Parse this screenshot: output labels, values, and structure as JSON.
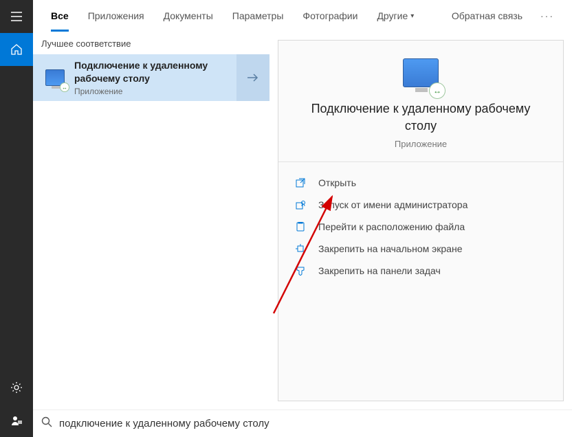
{
  "tabs": {
    "items": [
      {
        "label": "Все",
        "active": true
      },
      {
        "label": "Приложения",
        "active": false
      },
      {
        "label": "Документы",
        "active": false
      },
      {
        "label": "Параметры",
        "active": false
      },
      {
        "label": "Фотографии",
        "active": false
      },
      {
        "label": "Другие",
        "active": false,
        "has_dropdown": true
      }
    ],
    "feedback": "Обратная связь"
  },
  "left": {
    "section_title": "Лучшее соответствие",
    "result": {
      "title": "Подключение к удаленному рабочему столу",
      "subtitle": "Приложение"
    }
  },
  "details": {
    "title": "Подключение к удаленному рабочему столу",
    "subtitle": "Приложение",
    "actions": [
      {
        "label": "Открыть",
        "icon": "open"
      },
      {
        "label": "Запуск от имени администратора",
        "icon": "admin"
      },
      {
        "label": "Перейти к расположению файла",
        "icon": "folder"
      },
      {
        "label": "Закрепить на начальном экране",
        "icon": "pin-start"
      },
      {
        "label": "Закрепить на панели задач",
        "icon": "pin-taskbar"
      }
    ]
  },
  "search": {
    "value": "подключение к удаленному рабочему столу"
  },
  "colors": {
    "accent": "#0078d7",
    "result_bg": "#cfe4f7"
  }
}
